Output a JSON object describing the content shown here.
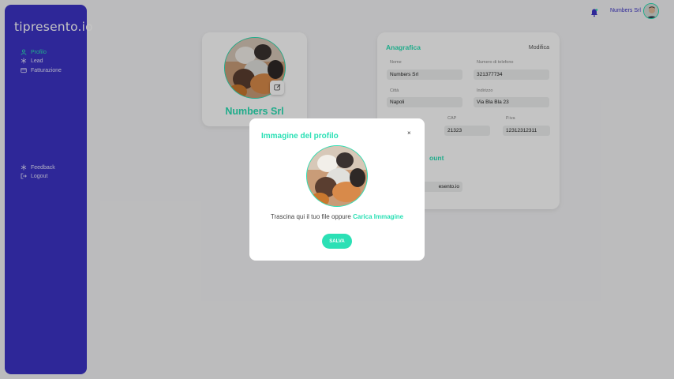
{
  "app": {
    "logo": "tipresento.io"
  },
  "sidebar": {
    "items": [
      {
        "label": "Profilo",
        "icon": "user-icon",
        "active": true
      },
      {
        "label": "Lead",
        "icon": "asterisk-icon",
        "active": false
      },
      {
        "label": "Fatturazione",
        "icon": "wallet-icon",
        "active": false
      }
    ],
    "bottom_items": [
      {
        "label": "Feedback",
        "icon": "asterisk-icon"
      },
      {
        "label": "Logout",
        "icon": "logout-icon"
      }
    ]
  },
  "header": {
    "user_name": "Numbers Srl",
    "bell_icon": "bell-icon"
  },
  "profile": {
    "company_name": "Numbers Srl"
  },
  "anagrafica": {
    "title": "Anagrafica",
    "edit_label": "Modifica",
    "fields": {
      "nome": {
        "label": "Nome",
        "value": "Numbers Srl"
      },
      "telefono": {
        "label": "Numero di telefono",
        "value": "321377734"
      },
      "citta": {
        "label": "Città",
        "value": "Napoli"
      },
      "indirizzo": {
        "label": "Indirizzo",
        "value": "Via Bla Bla 23"
      },
      "cap": {
        "label": "CAP",
        "value": "21323"
      },
      "piva": {
        "label": "P.iva",
        "value": "12312312311"
      }
    },
    "account_title_partial": "ount",
    "email_partial": "esento.io"
  },
  "modal": {
    "title": "Immagine del profilo",
    "close_label": "×",
    "text": "Trascina qui il tuo file oppure",
    "link": "Carica Immagine",
    "save_label": "SALVA"
  },
  "colors": {
    "accent": "#2be0b5",
    "sidebar": "#3c33c6"
  }
}
